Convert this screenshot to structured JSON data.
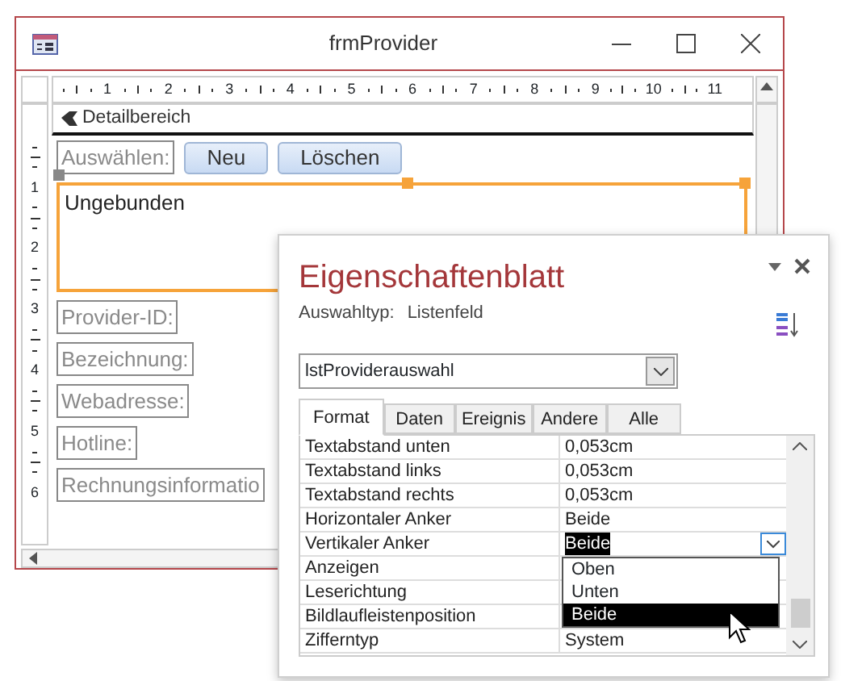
{
  "form_window": {
    "title": "frmProvider",
    "ruler_numbers": [
      "1",
      "2",
      "3",
      "4",
      "5",
      "6",
      "7",
      "8",
      "9",
      "10",
      "11"
    ],
    "side_ruler_numbers": [
      "1",
      "2",
      "3",
      "4",
      "5",
      "6"
    ],
    "section": "Detailbereich",
    "control_rows": [
      [
        {
          "kind": "label",
          "text": "Auswählen:",
          "selected": false
        },
        {
          "kind": "button",
          "text": "Neu",
          "selected": false
        },
        {
          "kind": "button",
          "text": "Löschen",
          "selected": false
        }
      ],
      [
        {
          "kind": "listbox",
          "text": "Ungebunden",
          "selected": true
        }
      ],
      [
        {
          "kind": "label",
          "text": "Provider-ID:",
          "selected": false
        }
      ],
      [
        {
          "kind": "label",
          "text": "Bezeichnung:",
          "selected": false
        }
      ],
      [
        {
          "kind": "label",
          "text": "Webadresse:",
          "selected": false
        }
      ],
      [
        {
          "kind": "label",
          "text": "Hotline:",
          "selected": false
        }
      ],
      [
        {
          "kind": "label",
          "text": "Rechnungsinformatio",
          "selected": false
        }
      ]
    ]
  },
  "property_sheet": {
    "title": "Eigenschaftenblatt",
    "selection_type_label": "Auswahltyp:",
    "selection_type": "Listenfeld",
    "object": "lstProviderauswahl",
    "tabs": [
      {
        "label": "Format",
        "selected": true
      },
      {
        "label": "Daten",
        "selected": false
      },
      {
        "label": "Ereignis",
        "selected": false
      },
      {
        "label": "Andere",
        "selected": false
      },
      {
        "label": "Alle",
        "selected": false
      }
    ],
    "properties": [
      {
        "name": "Textabstand unten",
        "value": "0,053cm",
        "selected": false
      },
      {
        "name": "Textabstand links",
        "value": "0,053cm",
        "selected": false
      },
      {
        "name": "Textabstand rechts",
        "value": "0,053cm",
        "selected": false
      },
      {
        "name": "Horizontaler Anker",
        "value": "Beide",
        "selected": false
      },
      {
        "name": "Vertikaler Anker",
        "value": "Beide",
        "selected": true,
        "options": [
          {
            "label": "Oben",
            "selected": false
          },
          {
            "label": "Unten",
            "selected": false
          },
          {
            "label": "Beide",
            "selected": true
          }
        ]
      },
      {
        "name": "Anzeigen",
        "selected": false
      },
      {
        "name": "Leserichtung",
        "selected": false
      },
      {
        "name": "Bildlaufleistenposition",
        "selected": false
      },
      {
        "name": "Zifferntyp",
        "value": "System",
        "selected": false
      }
    ]
  }
}
